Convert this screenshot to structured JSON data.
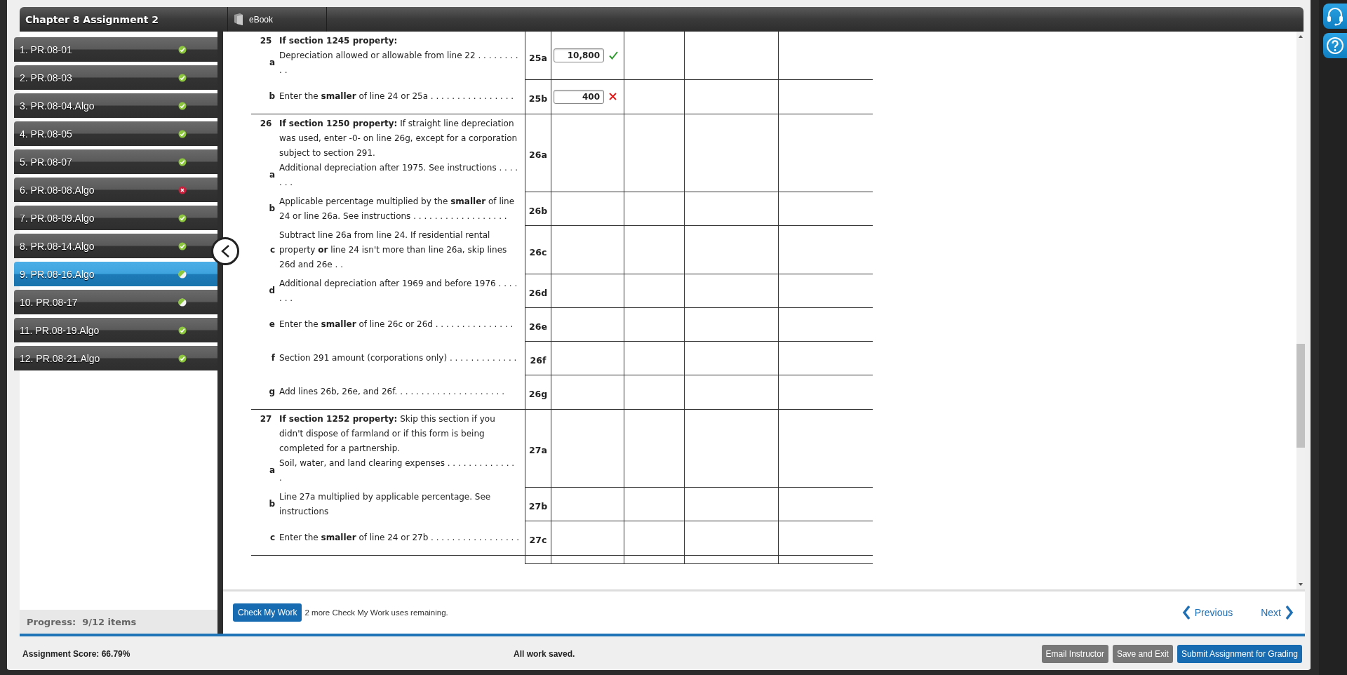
{
  "assignment": {
    "title": "Chapter 8 Assignment 2",
    "tabs": [
      {
        "label": "eBook"
      }
    ]
  },
  "sidebar": {
    "items": [
      {
        "label": "1. PR.08-01",
        "correct": true,
        "partial": false,
        "selected": false
      },
      {
        "label": "2. PR.08-03",
        "correct": true,
        "partial": false,
        "selected": false
      },
      {
        "label": "3. PR.08-04.Algo",
        "correct": true,
        "partial": false,
        "selected": false
      },
      {
        "label": "4. PR.08-05",
        "correct": true,
        "partial": false,
        "selected": false
      },
      {
        "label": "5. PR.08-07",
        "correct": true,
        "partial": false,
        "selected": false
      },
      {
        "label": "6. PR.08-08.Algo",
        "correct": false,
        "partial": false,
        "selected": false
      },
      {
        "label": "7. PR.08-09.Algo",
        "correct": true,
        "partial": false,
        "selected": false
      },
      {
        "label": "8. PR.08-14.Algo",
        "correct": true,
        "partial": false,
        "selected": false
      },
      {
        "label": "9. PR.08-16.Algo",
        "correct": true,
        "partial": true,
        "selected": true
      },
      {
        "label": "10. PR.08-17",
        "correct": true,
        "partial": true,
        "selected": false
      },
      {
        "label": "11. PR.08-19.Algo",
        "correct": true,
        "partial": false,
        "selected": false
      },
      {
        "label": "12. PR.08-21.Algo",
        "correct": true,
        "partial": false,
        "selected": false
      }
    ],
    "progress": "Progress:  9/12 items"
  },
  "form": {
    "sections": [
      {
        "number": "25",
        "heading": "If section 1245 property:",
        "items": [
          {
            "letter": "a",
            "text": "Depreciation allowed or allowable from line 22 . . . . . . . . . .",
            "line": "25a",
            "answer": {
              "value": "10,800",
              "correct": true
            }
          },
          {
            "letter": "b",
            "text": "Enter the **smaller** of line 24 or 25a . . . . . . . . . . . . . . . .",
            "line": "25b",
            "answer": {
              "value": "400",
              "correct": false
            }
          }
        ]
      },
      {
        "number": "26",
        "heading": "If section 1250 property:",
        "note": "If straight line depreciation was used, enter -0- on line 26g, except for a corporation subject to section 291.",
        "items": [
          {
            "letter": "a",
            "text": "Additional depreciation after 1975. See instructions . . . . . . .",
            "line": "26a"
          },
          {
            "letter": "b",
            "text": "Applicable percentage multiplied by the **smaller** of line 24 or line 26a. See instructions . . . . . . . . . . . . . . . . . .",
            "line": "26b"
          },
          {
            "letter": "c",
            "text": "Subtract line 26a from line 24. If residential rental property **or** line 24 isn't more than line 26a, skip lines 26d and 26e . .",
            "line": "26c"
          },
          {
            "letter": "d",
            "text": "Additional depreciation after 1969 and before 1976 . . . . . . .",
            "line": "26d"
          },
          {
            "letter": "e",
            "text": "Enter the **smaller** of line 26c or 26d . . . . . . . . . . . . . . .",
            "line": "26e"
          },
          {
            "letter": "f",
            "text": "Section 291 amount (corporations only) . . . . . . . . . . . . .",
            "line": "26f"
          },
          {
            "letter": "g",
            "text": "Add lines 26b, 26e, and 26f. . . . . . . . . . . . . . . . . . . . .",
            "line": "26g"
          }
        ]
      },
      {
        "number": "27",
        "heading": "If section 1252 property:",
        "note": "Skip this section if you didn't dispose of farmland or if this form is being completed for a partnership.",
        "items": [
          {
            "letter": "a",
            "text": "Soil, water, and land clearing expenses . . . . . . . . . . . . . .",
            "line": "27a"
          },
          {
            "letter": "b",
            "text": "Line 27a multiplied by applicable percentage. See instructions",
            "line": "27b"
          },
          {
            "letter": "c",
            "text": "Enter the **smaller** of line 24 or 27b . . . . . . . . . . . . . . . . .",
            "line": "27c"
          }
        ]
      }
    ]
  },
  "actions": {
    "check_button": "Check My Work",
    "remaining": "2 more Check My Work uses remaining.",
    "previous": "Previous",
    "next": "Next"
  },
  "footer": {
    "score": "Assignment Score: 66.79%",
    "save_status": "All work saved.",
    "buttons": [
      {
        "label": "Email Instructor",
        "primary": false
      },
      {
        "label": "Save and Exit",
        "primary": false
      },
      {
        "label": "Submit Assignment for Grading",
        "primary": true
      }
    ]
  }
}
